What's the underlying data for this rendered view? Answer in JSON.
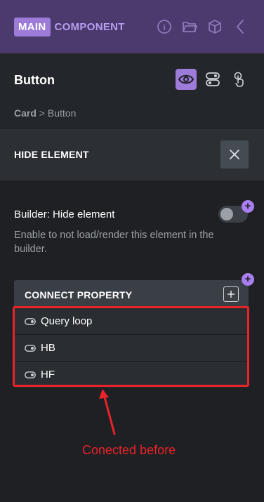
{
  "header": {
    "badge": "MAIN",
    "label": "COMPONENT",
    "icons": [
      "info-icon",
      "folder-icon",
      "cube-icon",
      "chevron-left-icon"
    ]
  },
  "panel": {
    "title": "Button",
    "modes": [
      "eye-icon",
      "toggles-icon",
      "touch-icon"
    ],
    "breadcrumb": {
      "parent": "Card",
      "separator": ">",
      "current": "Button"
    }
  },
  "section": {
    "title": "HIDE ELEMENT"
  },
  "setting": {
    "label": "Builder: Hide element",
    "description": "Enable to not load/render this element in the builder.",
    "enabled": false
  },
  "connect": {
    "title": "CONNECT PROPERTY",
    "items": [
      {
        "label": "Query loop"
      },
      {
        "label": "HB"
      },
      {
        "label": "HF"
      }
    ]
  },
  "annotation": {
    "text": "Conected before"
  },
  "colors": {
    "header_bg": "#4a3a6e",
    "accent": "#9d7bd8",
    "annotation_red": "#e8232a"
  }
}
